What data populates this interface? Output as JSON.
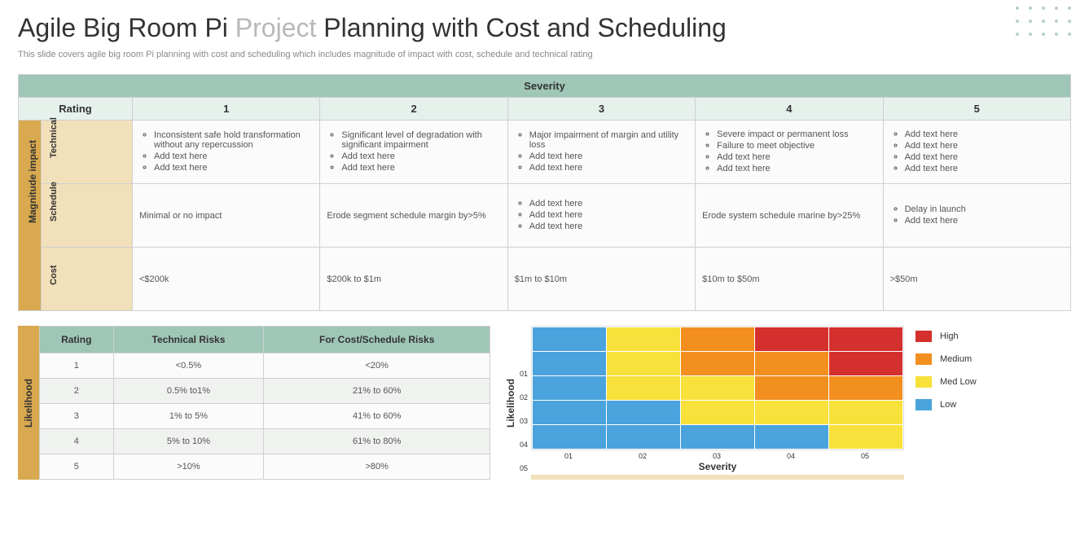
{
  "title_pre": "Agile Big Room Pi ",
  "title_accent": "Project",
  "title_post": " Planning with Cost and Scheduling",
  "subtitle": "This slide covers agile big room Pi planning with cost and scheduling which includes magnitude of impact with cost, schedule and technical rating",
  "severity_label": "Severity",
  "rating_label": "Rating",
  "magnitude_label": "Magnitude impact",
  "col_nums": [
    "1",
    "2",
    "3",
    "4",
    "5"
  ],
  "rows": {
    "technical": {
      "label": "Technical",
      "cells": [
        [
          "Inconsistent safe hold transformation without any repercussion",
          "Add text here",
          "Add text here"
        ],
        [
          "Significant level of degradation with significant impairment",
          "Add text here",
          "Add text here"
        ],
        [
          "Major impairment of margin and utility loss",
          "Add text here",
          "Add text here"
        ],
        [
          "Severe impact or permanent loss",
          "Failure to meet objective",
          "Add text here",
          "Add text here"
        ],
        [
          "Add text here",
          "Add text here",
          "Add text here",
          "Add text here"
        ]
      ]
    },
    "schedule": {
      "label": "Schedule",
      "cells": [
        [
          "Minimal or no impact"
        ],
        [
          "Erode segment schedule margin by>5%"
        ],
        [
          "Add text here",
          "Add text here",
          "Add text here"
        ],
        [
          "Erode system schedule marine by>25%"
        ],
        [
          "Delay in launch",
          "Add text here"
        ]
      ]
    },
    "cost": {
      "label": "Cost",
      "cells": [
        [
          "<$200k"
        ],
        [
          "$200k to $1m"
        ],
        [
          "$1m to $10m"
        ],
        [
          "$10m to $50m"
        ],
        [
          ">$50m"
        ]
      ]
    }
  },
  "likelihood_label": "Likelihood",
  "likelihood_headers": [
    "Rating",
    "Technical Risks",
    "For Cost/Schedule Risks"
  ],
  "likelihood_rows": [
    [
      "1",
      "<0.5%",
      "<20%"
    ],
    [
      "2",
      "0.5% to1%",
      "21% to 60%"
    ],
    [
      "3",
      "1% to 5%",
      "41% to 60%"
    ],
    [
      "4",
      "5% to 10%",
      "61% to 80%"
    ],
    [
      "5",
      ">10%",
      ">80%"
    ]
  ],
  "chart_data": {
    "type": "heatmap",
    "xlabel": "Severity",
    "ylabel": "Likelihood",
    "x_ticks": [
      "01",
      "02",
      "03",
      "04",
      "05"
    ],
    "y_ticks": [
      "01",
      "02",
      "03",
      "04",
      "05"
    ],
    "levels": [
      "Low",
      "Med Low",
      "Medium",
      "High"
    ],
    "level_colors": [
      "#4aa3dc",
      "#f7e13a",
      "#f28f1f",
      "#d4302e"
    ],
    "grid_levels": [
      [
        "Low",
        "Med Low",
        "Medium",
        "High",
        "High"
      ],
      [
        "Low",
        "Med Low",
        "Medium",
        "Medium",
        "High"
      ],
      [
        "Low",
        "Med Low",
        "Med Low",
        "Medium",
        "Medium"
      ],
      [
        "Low",
        "Low",
        "Med Low",
        "Med Low",
        "Med Low"
      ],
      [
        "Low",
        "Low",
        "Low",
        "Low",
        "Med Low"
      ]
    ],
    "legend": [
      {
        "label": "High",
        "color": "#d4302e"
      },
      {
        "label": "Medium",
        "color": "#f28f1f"
      },
      {
        "label": "Med Low",
        "color": "#f7e13a"
      },
      {
        "label": "Low",
        "color": "#4aa3dc"
      }
    ]
  }
}
